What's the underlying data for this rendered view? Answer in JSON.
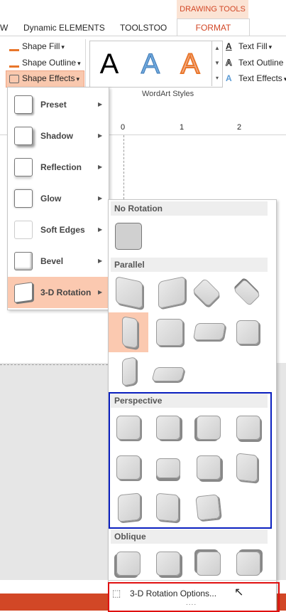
{
  "ribbon": {
    "context_tab": "DRAWING TOOLS",
    "tabs": [
      "W",
      "Dynamic ELEMENTS",
      "TOOLSTOO",
      "FORMAT"
    ],
    "shape_fill": "Shape Fill",
    "shape_outline": "Shape Outline",
    "shape_effects": "Shape Effects",
    "wordart_letter": "A",
    "wordart_label": "WordArt Styles",
    "text_fill": "Text Fill",
    "text_outline": "Text Outline",
    "text_effects": "Text Effects",
    "text_icon_letter": "A",
    "dropdown_glyph": "▾"
  },
  "ruler": {
    "marks": [
      "0",
      "1",
      "2"
    ]
  },
  "effects_menu": {
    "items": [
      {
        "label": "Preset"
      },
      {
        "label": "Shadow"
      },
      {
        "label": "Reflection"
      },
      {
        "label": "Glow"
      },
      {
        "label": "Soft Edges"
      },
      {
        "label": "Bevel"
      },
      {
        "label": "3-D Rotation"
      }
    ],
    "arrow_glyph": "▶"
  },
  "rotation_submenu": {
    "sections": {
      "no_rotation": "No Rotation",
      "parallel": "Parallel",
      "perspective": "Perspective",
      "oblique": "Oblique"
    },
    "options_label": "3-D Rotation Options...",
    "gripper": "....",
    "highlight_colors": {
      "perspective": "#0a1fbf",
      "options": "#e01010"
    }
  },
  "colors": {
    "accent": "#d24726",
    "selection": "#fbc9b0"
  }
}
